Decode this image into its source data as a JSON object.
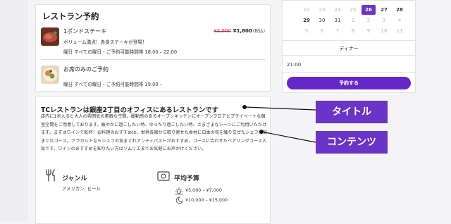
{
  "reservation": {
    "title": "レストラン予約",
    "plans": [
      {
        "name": "1ポンドステーキ",
        "old_price": "¥2,000",
        "price": "¥1,800",
        "tax_note": "(税込)",
        "description": "ボリューム満点！赤身ステーキが登場！",
        "schedule": "曜日 すべての曜日・ご予約可能時間帯 18:00 – 22:00",
        "thumb_color": "#b5523f"
      },
      {
        "name": "お席のみのご予約",
        "schedule": "曜日 すべての曜日・ご予約可能時間帯 19:00 –",
        "thumb_color": "#d58a3a"
      }
    ]
  },
  "info": {
    "title": "TCレストランは銀座2丁目のオフィスにあるレストランです",
    "body": "店内に1歩入ると大人の雰囲気の素敵な空間。躍動感のあるオープンキッチンにオープンフロアとプライベートな個室空間をご用意しております。賑やかに過ごしたい時、ゆったり過ごしたい時、さまざまなシーンにご利用いただけます。まずはワインで乾杯！お料理のおすすめは、世界各国から取り寄せた食材に日本の旬を織り交ぜたシェフの気まぐれコース。アラカルトならシェフの気まぐれアンティパストがおすすめ。コースに合わせたペアリングコース人気です。ワインのおすすめを知りたい方はソムリエまでお気軽にお声かけください。",
    "genre": {
      "label": "ジャンル",
      "value": "アメリカン, ビール"
    },
    "budget": {
      "label": "平均予算",
      "dinner": "¥5,000 – ¥7,000",
      "lunch": "¥10,000 – ¥15,000"
    }
  },
  "calendar": {
    "rows": [
      [
        "22",
        "23",
        "24",
        "25",
        "26",
        "27",
        "28"
      ],
      [
        "29",
        "30",
        "31",
        "1",
        "2",
        "3",
        "4"
      ],
      [
        "5",
        "6",
        "7",
        "8",
        "9",
        "10",
        "11"
      ]
    ],
    "selected": "26",
    "course": "ディナー",
    "time": "21:00",
    "reserve_label": "予約する",
    "accent": "#6527c9"
  },
  "annotations": {
    "title_label": "タイトル",
    "content_label": "コンテンツ"
  }
}
